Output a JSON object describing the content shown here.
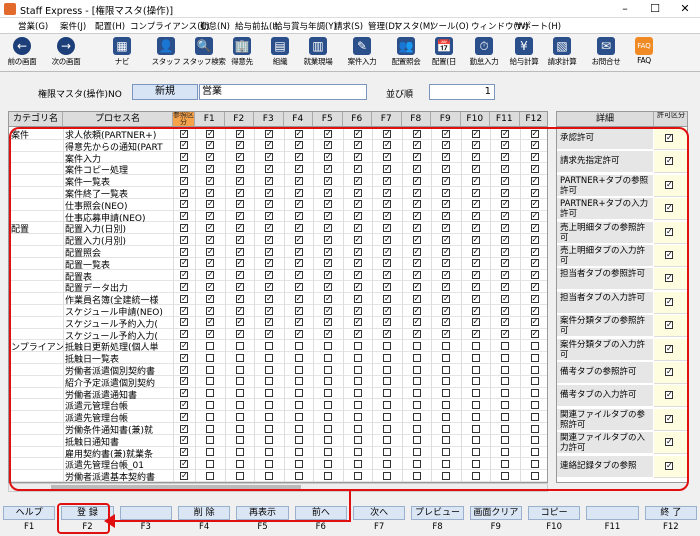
{
  "window": {
    "title": "Staff Express - [権限マスタ(操作)]"
  },
  "menu": [
    "営業(G)",
    "案件(J)",
    "配置(H)",
    "コンプライアンス(C)",
    "勤怠(N)",
    "給与前払(I)",
    "給与賞与年調(Y)",
    "請求(S)",
    "管理(D)",
    "マスタ(M)",
    "ツール(O)",
    "ウィンドウ(W)",
    "サポート(H)"
  ],
  "toolbar": [
    {
      "label": "前の画面",
      "icon": "←"
    },
    {
      "label": "次の画面",
      "icon": "→"
    },
    {
      "label": "ナビ",
      "icon": "▦"
    },
    {
      "label": "スタッフ",
      "icon": "👤"
    },
    {
      "label": "スタッフ検索",
      "icon": "🔍"
    },
    {
      "label": "得意先",
      "icon": "🏢"
    },
    {
      "label": "組織",
      "icon": "▤"
    },
    {
      "label": "就業現場",
      "icon": "▥"
    },
    {
      "label": "案件入力",
      "icon": "✎"
    },
    {
      "label": "配置照会",
      "icon": "👥"
    },
    {
      "label": "配置(日",
      "icon": "📅"
    },
    {
      "label": "勤怠入力",
      "icon": "⏱"
    },
    {
      "label": "給与計算",
      "icon": "¥"
    },
    {
      "label": "請求計算",
      "icon": "▧"
    },
    {
      "label": "お問合せ",
      "icon": "✉"
    },
    {
      "label": "FAQ",
      "icon": "FAQ"
    }
  ],
  "filter": {
    "label": "権限マスタ(操作)NO",
    "mode": "新規",
    "name_value": "営業",
    "order_label": "並び順",
    "order_value": "1"
  },
  "grid": {
    "header_category": "カテゴリ名",
    "header_process": "プロセス名",
    "header_view": "参照区分",
    "fkey_headers": [
      "F1",
      "F2",
      "F3",
      "F4",
      "F5",
      "F6",
      "F7",
      "F8",
      "F9",
      "F10",
      "F11",
      "F12"
    ],
    "rows": [
      {
        "cat": "案件",
        "proc": "求人依頼(PARTNER+)"
      },
      {
        "cat": "",
        "proc": "得意先からの通知(PART"
      },
      {
        "cat": "",
        "proc": "案件入力"
      },
      {
        "cat": "",
        "proc": "案件コピー処理"
      },
      {
        "cat": "",
        "proc": "案件一覧表"
      },
      {
        "cat": "",
        "proc": "案件終了一覧表"
      },
      {
        "cat": "",
        "proc": "仕事照会(NEO)"
      },
      {
        "cat": "",
        "proc": "仕事応募申請(NEO)"
      },
      {
        "cat": "配置",
        "proc": "配置入力(日別)"
      },
      {
        "cat": "",
        "proc": "配置入力(月別)"
      },
      {
        "cat": "",
        "proc": "配置照会"
      },
      {
        "cat": "",
        "proc": "配置一覧表"
      },
      {
        "cat": "",
        "proc": "配置表"
      },
      {
        "cat": "",
        "proc": "配置データ出力"
      },
      {
        "cat": "",
        "proc": "作業員名簿(全建統一様"
      },
      {
        "cat": "",
        "proc": "スケジュール申請(NEO)"
      },
      {
        "cat": "",
        "proc": "スケジュール予約入力("
      },
      {
        "cat": "",
        "proc": "スケジュール予約入力("
      },
      {
        "cat": "ンプライアン",
        "proc": "抵触日更新処理(個人単"
      },
      {
        "cat": "",
        "proc": "抵触日一覧表"
      },
      {
        "cat": "",
        "proc": "労働者派遣個別契約書"
      },
      {
        "cat": "",
        "proc": "紹介予定派遣個別契約"
      },
      {
        "cat": "",
        "proc": "労働者派遣通知書"
      },
      {
        "cat": "",
        "proc": "派遣元管理台帳"
      },
      {
        "cat": "",
        "proc": "派遣先管理台帳"
      },
      {
        "cat": "",
        "proc": "労働条件通知書(兼)就"
      },
      {
        "cat": "",
        "proc": "抵触日通知書"
      },
      {
        "cat": "",
        "proc": "雇用契約書(兼)就業条"
      },
      {
        "cat": "",
        "proc": "派遣先管理台帳_01"
      },
      {
        "cat": "",
        "proc": "労働者派遣基本契約書"
      }
    ]
  },
  "detail": {
    "header_label": "詳細",
    "header_flag": "許可区分",
    "items": [
      {
        "label": "承認許可",
        "checked": true
      },
      {
        "label": "請求先指定許可",
        "checked": true
      },
      {
        "label": "PARTNER+タブの参照許可",
        "checked": true
      },
      {
        "label": "PARTNER+タブの入力許可",
        "checked": true
      },
      {
        "label": "売上明細タブの参照許可",
        "checked": true
      },
      {
        "label": "売上明細タブの入力許可",
        "checked": true
      },
      {
        "label": "担当者タブの参照許可",
        "checked": true
      },
      {
        "label": "担当者タブの入力許可",
        "checked": true
      },
      {
        "label": "案件分類タブの参照許可",
        "checked": true
      },
      {
        "label": "案件分類タブの入力許可",
        "checked": true
      },
      {
        "label": "備考タブの参照許可",
        "checked": true
      },
      {
        "label": "備考タブの入力許可",
        "checked": true
      },
      {
        "label": "関連ファイルタブの参照許可",
        "checked": true
      },
      {
        "label": "関連ファイルタブの入力許可",
        "checked": true
      },
      {
        "label": "連絡記録タブの参照",
        "checked": true
      }
    ]
  },
  "fkeys": [
    {
      "key": "F1",
      "label": "ヘルプ"
    },
    {
      "key": "F2",
      "label": "登 録"
    },
    {
      "key": "F3",
      "label": ""
    },
    {
      "key": "F4",
      "label": "削 除"
    },
    {
      "key": "F5",
      "label": "再表示"
    },
    {
      "key": "F6",
      "label": "前へ"
    },
    {
      "key": "F7",
      "label": "次へ"
    },
    {
      "key": "F8",
      "label": "プレビュー"
    },
    {
      "key": "F9",
      "label": "画面クリア"
    },
    {
      "key": "F10",
      "label": "コピー"
    },
    {
      "key": "F11",
      "label": ""
    },
    {
      "key": "F12",
      "label": "終 了"
    }
  ],
  "colors": {
    "highlight": "#e01010",
    "header_orange": "#f6a24a",
    "fkey_bg": "#dbe6f4"
  }
}
